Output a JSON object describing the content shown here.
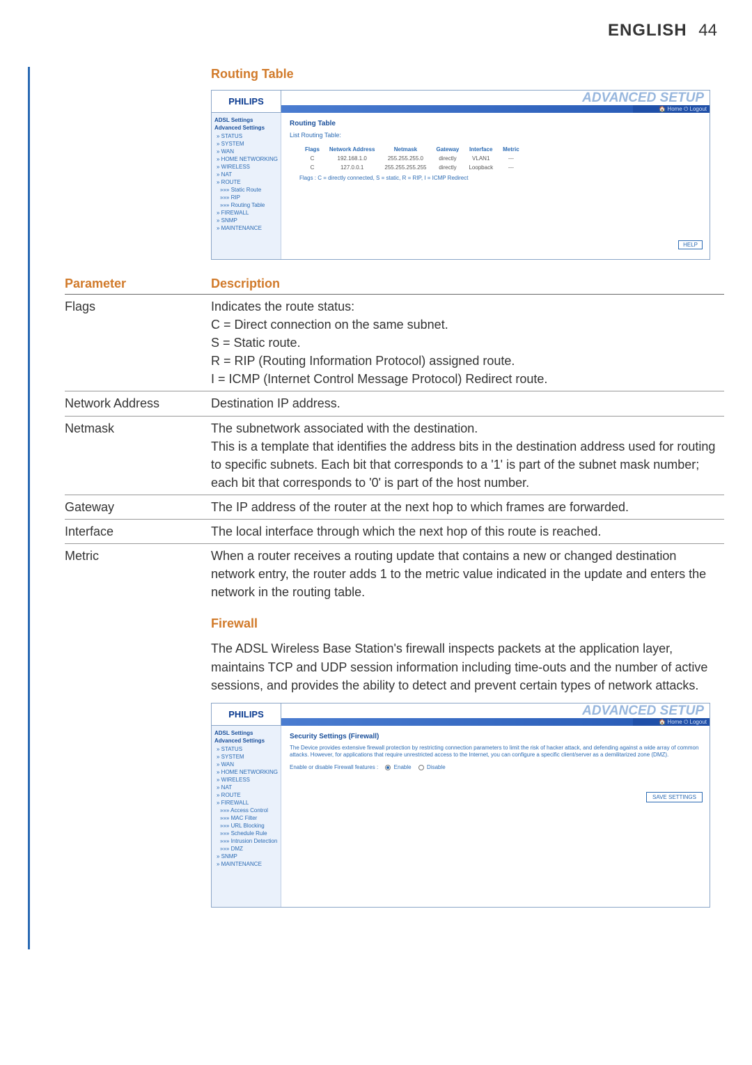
{
  "header": {
    "language": "ENGLISH",
    "page_number": "44"
  },
  "section1_title": "Routing Table",
  "screenshot_routing": {
    "logo": "PHILIPS",
    "banner_title": "ADVANCED SETUP",
    "banner_links": "🏠 Home  ⏻ Logout",
    "sidebar": {
      "group1": "ADSL Settings",
      "group2": "Advanced Settings",
      "items": [
        "» STATUS",
        "» SYSTEM",
        "» WAN",
        "» HOME NETWORKING",
        "» WIRELESS",
        "» NAT",
        "» ROUTE",
        "»»» Static Route",
        "»»» RIP",
        "»»» Routing Table",
        "» FIREWALL",
        "» SNMP",
        "» MAINTENANCE"
      ]
    },
    "main": {
      "title": "Routing Table",
      "subtitle": "List Routing Table:",
      "columns": [
        "Flags",
        "Network Address",
        "Netmask",
        "Gateway",
        "Interface",
        "Metric"
      ],
      "rows": [
        [
          "C",
          "192.168.1.0",
          "255.255.255.0",
          "directly",
          "VLAN1",
          "---"
        ],
        [
          "C",
          "127.0.0.1",
          "255.255.255.255",
          "directly",
          "Loopback",
          "---"
        ]
      ],
      "legend": "Flags :   C = directly connected, S = static, R = RIP, I = ICMP Redirect",
      "help": "HELP"
    }
  },
  "param_table": {
    "head_param": "Parameter",
    "head_desc": "Description",
    "rows": [
      {
        "param": "Flags",
        "desc": "Indicates the route status:\nC = Direct connection on the same subnet.\nS = Static route.\nR = RIP (Routing Information Protocol) assigned route.\nI = ICMP (Internet Control Message Protocol) Redirect route."
      },
      {
        "param": "Network Address",
        "desc": "Destination IP address."
      },
      {
        "param": "Netmask",
        "desc": "The subnetwork associated with the destination.\nThis is a template that identifies the address bits in the destination address used for routing to specific subnets. Each bit that corresponds to a '1' is part of the subnet mask number; each bit that corresponds to '0' is part of the host number."
      },
      {
        "param": "Gateway",
        "desc": "The IP address of the router at the next hop to which frames are forwarded."
      },
      {
        "param": "Interface",
        "desc": "The local interface through which the next hop of this route is reached."
      },
      {
        "param": "Metric",
        "desc": "When a router receives a routing update that contains a new or changed destination network entry, the router adds 1 to the metric value indicated in the update and enters the network in the routing table."
      }
    ]
  },
  "section2_title": "Firewall",
  "firewall_intro": "The ADSL Wireless Base Station's firewall inspects packets at the application layer, maintains TCP and UDP session information including time-outs and the number of active sessions, and provides the ability to detect and prevent certain types of network attacks.",
  "screenshot_firewall": {
    "logo": "PHILIPS",
    "banner_title": "ADVANCED SETUP",
    "banner_links": "🏠 Home  ⏻ Logout",
    "sidebar": {
      "group1": "ADSL Settings",
      "group2": "Advanced Settings",
      "items": [
        "» STATUS",
        "» SYSTEM",
        "» WAN",
        "» HOME NETWORKING",
        "» WIRELESS",
        "» NAT",
        "» ROUTE",
        "» FIREWALL",
        "»»» Access Control",
        "»»» MAC Filter",
        "»»» URL Blocking",
        "»»» Schedule Rule",
        "»»» Intrusion Detection",
        "»»» DMZ",
        "» SNMP",
        "» MAINTENANCE"
      ]
    },
    "main": {
      "title": "Security Settings (Firewall)",
      "desc": "The Device provides extensive firewall protection by restricting connection parameters to limit the risk of hacker attack, and defending against a wide array of common attacks. However, for applications that require unrestricted access to the Internet, you can configure a specific client/server as a demilitarized zone (DMZ).",
      "enable_label": "Enable or disable Firewall features :",
      "opt_enable": "Enable",
      "opt_disable": "Disable",
      "save": "SAVE SETTINGS"
    }
  }
}
